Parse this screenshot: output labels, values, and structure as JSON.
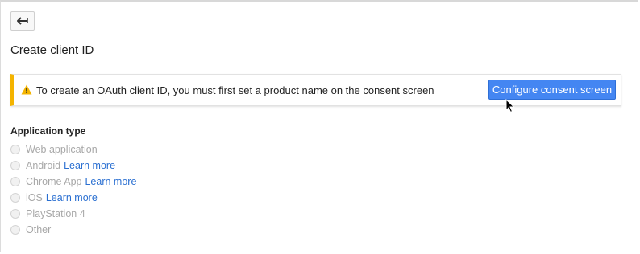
{
  "page": {
    "title": "Create client ID"
  },
  "back_button": {
    "icon": "back-arrow-icon"
  },
  "warning": {
    "icon": "warning-icon",
    "message": "To create an OAuth client ID, you must first set a product name on the consent screen",
    "button_label": "Configure consent screen",
    "accent_color": "#f4b400"
  },
  "application_type": {
    "label": "Application type",
    "options": [
      {
        "label": "Web application",
        "link": ""
      },
      {
        "label": "Android",
        "link": "Learn more"
      },
      {
        "label": "Chrome App",
        "link": "Learn more"
      },
      {
        "label": "iOS",
        "link": "Learn more"
      },
      {
        "label": "PlayStation 4",
        "link": ""
      },
      {
        "label": "Other",
        "link": ""
      }
    ]
  },
  "colors": {
    "primary_button": "#4486f2",
    "link": "#2a6fd1",
    "disabled_text": "#a8a8a8"
  }
}
